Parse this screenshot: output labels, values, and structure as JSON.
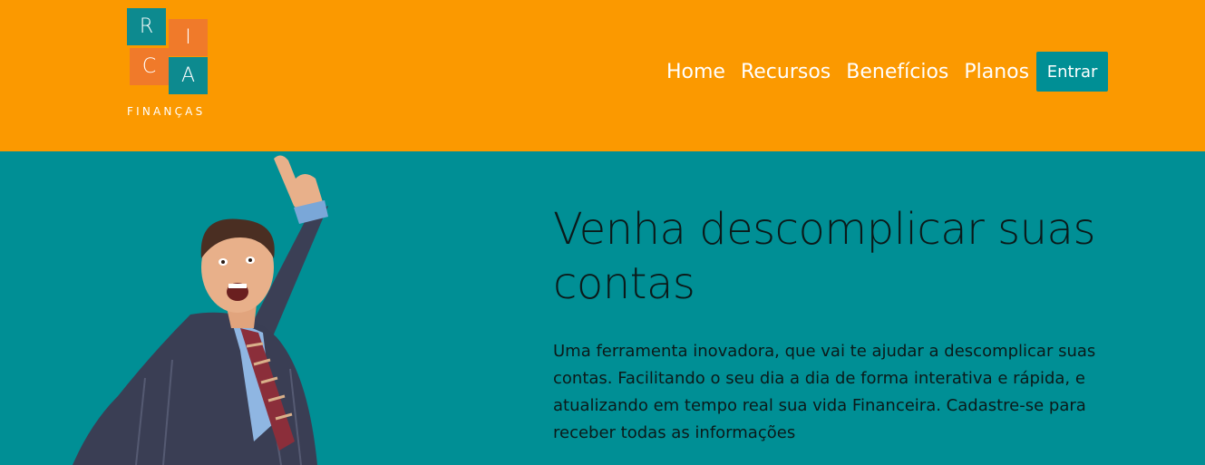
{
  "brand": {
    "letters": [
      "R",
      "I",
      "C",
      "A"
    ],
    "subtitle": "FINANÇAS",
    "colors": {
      "header": "#fb9900",
      "teal": "#008f95",
      "tile_orange": "#f07a2a"
    }
  },
  "nav": {
    "items": [
      "Home",
      "Recursos",
      "Benefícios",
      "Planos"
    ],
    "cta": "Entrar"
  },
  "hero": {
    "title": "Venha descomplicar suas contas",
    "text": "Uma ferramenta inovadora, que vai te ajudar a descomplicar suas contas. Facilitando o seu dia a dia de forma interativa e rápida, e atualizando em tempo real sua vida Financeira. Cadastre-se para receber todas as informações",
    "image_icon": "excited-businessman-photo"
  }
}
